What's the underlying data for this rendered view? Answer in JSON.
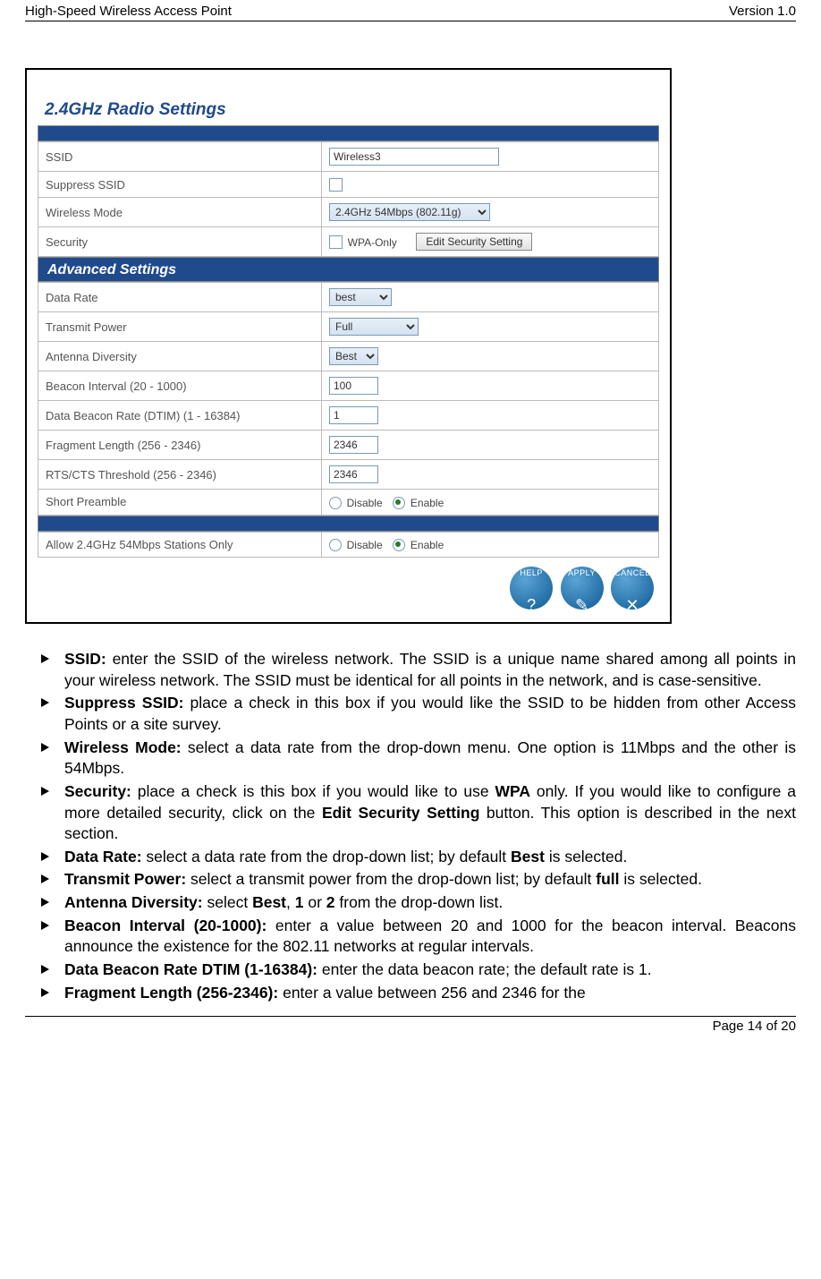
{
  "header": {
    "title": "High-Speed Wireless Access Point",
    "version": "Version 1.0"
  },
  "panel": {
    "title": "2.4GHz Radio Settings",
    "advanced_title": "Advanced Settings",
    "rows": {
      "ssid_label": "SSID",
      "ssid_value": "Wireless3",
      "suppress_label": "Suppress SSID",
      "mode_label": "Wireless Mode",
      "mode_value": "2.4GHz 54Mbps (802.11g)",
      "security_label": "Security",
      "security_wpa_label": "WPA-Only",
      "security_btn": "Edit Security Setting",
      "rate_label": "Data Rate",
      "rate_value": "best",
      "tx_label": "Transmit Power",
      "tx_value": "Full",
      "ant_label": "Antenna Diversity",
      "ant_value": "Best",
      "beacon_label": "Beacon Interval (20 - 1000)",
      "beacon_value": "100",
      "dtim_label": "Data Beacon Rate (DTIM) (1 - 16384)",
      "dtim_value": "1",
      "frag_label": "Fragment Length (256 - 2346)",
      "frag_value": "2346",
      "rts_label": "RTS/CTS Threshold (256 - 2346)",
      "rts_value": "2346",
      "preamble_label": "Short Preamble",
      "disable": "Disable",
      "enable": "Enable",
      "allow_label": "Allow 2.4GHz 54Mbps Stations Only"
    },
    "buttons": {
      "help": "HELP",
      "apply": "APPLY",
      "cancel": "CANCEL"
    }
  },
  "bullets": {
    "ssid_t": "SSID:",
    "ssid": " enter the SSID of the wireless network. The SSID is a unique name shared among all points in your wireless network. The SSID must be identical for all points in the network, and is case-sensitive.",
    "suppress_t": "Suppress SSID:",
    "suppress": " place a check in this box if you would like the SSID to be hidden from other Access Points or a site survey.",
    "mode_t": "Wireless Mode:",
    "mode": " select a data rate from the drop-down menu. One option is 11Mbps and the other is 54Mbps.",
    "sec_t": "Security:",
    "sec_a": " place a check is this box if you would like to use ",
    "sec_wpa": "WPA",
    "sec_b": " only. If you would like to configure a more detailed security, click on the ",
    "sec_btn": "Edit Security Setting",
    "sec_c": " button. This option is described in the next section.",
    "rate_t": "Data Rate:",
    "rate_a": " select a data rate from the drop-down list; by default ",
    "rate_best": "Best",
    "rate_b": " is selected.",
    "tx_t": "Transmit Power:",
    "tx_a": " select a transmit power from the drop-down list; by default ",
    "tx_full": "full",
    "tx_b": " is selected.",
    "ant_t": "Antenna Diversity:",
    "ant_a": " select ",
    "ant_best": "Best",
    "ant_comma": ", ",
    "ant_1": "1",
    "ant_or": " or ",
    "ant_2": "2",
    "ant_b": " from the drop-down list.",
    "beacon_t": "Beacon Interval (20-1000):",
    "beacon": " enter a value between 20 and 1000 for the beacon interval. Beacons announce the existence for the 802.11 networks at regular intervals.",
    "dtim_t": "Data Beacon Rate DTIM (1-16384):",
    "dtim": " enter the data beacon rate; the default rate is 1.",
    "frag_t": "Fragment Length (256-2346):",
    "frag": " enter a value between 256 and 2346 for the"
  },
  "footer": {
    "page": "Page 14 of 20"
  }
}
